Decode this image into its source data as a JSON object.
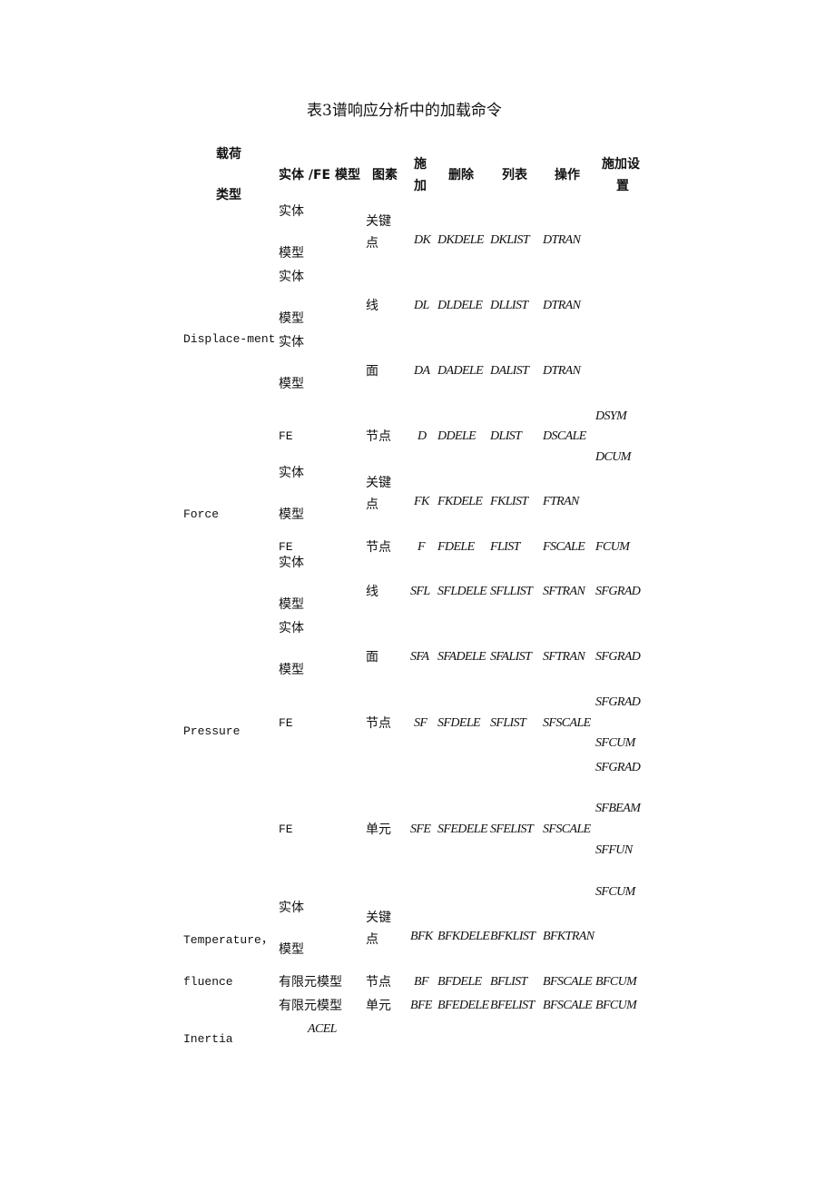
{
  "title": "表3谱响应分析中的加载命令",
  "header": {
    "load_type_1": "载荷",
    "load_type_2": "类型",
    "model": "实体 /FE 模型",
    "entity": "图素",
    "apply_1": "施",
    "apply_2": "加",
    "delete": "删除",
    "list": "列表",
    "operate": "操作",
    "settings_1": "施加设",
    "settings_2": "置"
  },
  "groups": {
    "displacement": "Displace-ment",
    "force": "Force",
    "pressure": "Pressure",
    "temperature": "Temperature，",
    "fluence": "fluence",
    "inertia": "Inertia"
  },
  "rows": [
    {
      "model_1": "实体",
      "model_2": "模型",
      "entity_1": "关键",
      "entity_2": "点",
      "apply": "DK",
      "delete": "DKDELE",
      "list": "DKLIST",
      "operate": "DTRAN"
    },
    {
      "model_1": "实体",
      "model_2": "模型",
      "entity": "线",
      "apply": "DL",
      "delete": "DLDELE",
      "list": "DLLIST",
      "operate": "DTRAN"
    },
    {
      "model_1": "实体",
      "model_2": "模型",
      "entity": "面",
      "apply": "DA",
      "delete": "DADELE",
      "list": "DALIST",
      "operate": "DTRAN"
    },
    {
      "model": "FE",
      "entity": "节点",
      "apply": "D",
      "delete": "DDELE",
      "list": "DLIST",
      "operate": "DSCALE",
      "settings": [
        "DSYM",
        "DCUM"
      ]
    },
    {
      "model_1": "实体",
      "model_2": "模型",
      "entity_1": "关键",
      "entity_2": "点",
      "apply": "FK",
      "delete": "FKDELE",
      "list": "FKLIST",
      "operate": "FTRAN"
    },
    {
      "model": "FE",
      "entity": "节点",
      "apply": "F",
      "delete": "FDELE",
      "list": "FLIST",
      "operate": "FSCALE",
      "settings": [
        "FCUM"
      ]
    },
    {
      "model_1": "实体",
      "model_2": "模型",
      "entity": "线",
      "apply": "SFL",
      "delete": "SFLDELE",
      "list": "SFLLIST",
      "operate": "SFTRAN",
      "settings": [
        "SFGRAD"
      ]
    },
    {
      "model_1": "实体",
      "model_2": "模型",
      "entity": "面",
      "apply": "SFA",
      "delete": "SFADELE",
      "list": "SFALIST",
      "operate": "SFTRAN",
      "settings": [
        "SFGRAD"
      ]
    },
    {
      "model": "FE",
      "entity": "节点",
      "apply": "SF",
      "delete": "SFDELE",
      "list": "SFLIST",
      "operate": "SFSCALE",
      "settings": [
        "SFGRAD",
        "SFCUM"
      ]
    },
    {
      "model": "FE",
      "entity": "单元",
      "apply": "SFE",
      "delete": "SFEDELE",
      "list": "SFELIST",
      "operate": "SFSCALE",
      "settings": [
        "SFGRAD",
        "SFBEAM",
        "SFFUN",
        "SFCUM"
      ]
    },
    {
      "model_1": "实体",
      "model_2": "模型",
      "entity_1": "关键",
      "entity_2": "点",
      "apply": "BFK",
      "delete": "BFKDELE",
      "list": "BFKLIST",
      "operate": "BFKTRAN"
    },
    {
      "model": "有限元模型",
      "entity": "节点",
      "apply": "BF",
      "delete": "BFDELE",
      "list": "BFLIST",
      "operate": "BFSCALE",
      "settings": [
        "BFCUM"
      ]
    },
    {
      "model": "有限元模型",
      "entity": "单元",
      "apply": "BFE",
      "delete": "BFEDELE",
      "list": "BFELIST",
      "operate": "BFSCALE",
      "settings": [
        "BFCUM"
      ]
    },
    {
      "apply": "ACEL"
    }
  ]
}
